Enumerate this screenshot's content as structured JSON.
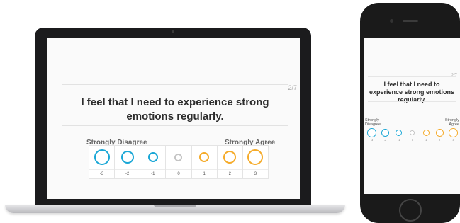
{
  "colors": {
    "blue": "#1aa7d6",
    "gray": "#c4c4c4",
    "orange": "#f5ab2a"
  },
  "laptop": {
    "progress": "2/7",
    "question": "I feel that I need to experience strong emotions regularly.",
    "label_left": "Strongly Disagree",
    "label_right": "Strongly Agree",
    "options": [
      {
        "value": "-3",
        "size": 22,
        "color": "#1aa7d6"
      },
      {
        "value": "-2",
        "size": 18,
        "color": "#1aa7d6"
      },
      {
        "value": "-1",
        "size": 14,
        "color": "#1aa7d6"
      },
      {
        "value": "0",
        "size": 11,
        "color": "#c4c4c4"
      },
      {
        "value": "1",
        "size": 14,
        "color": "#f5ab2a"
      },
      {
        "value": "2",
        "size": 18,
        "color": "#f5ab2a"
      },
      {
        "value": "3",
        "size": 22,
        "color": "#f5ab2a"
      }
    ]
  },
  "phone": {
    "progress": "2/7",
    "question": "I feel that I need to experience strong emotions regularly.",
    "label_left": "Strongly Disagree",
    "label_right": "Strongly Agree",
    "options": [
      {
        "value": "-3",
        "size": 13,
        "color": "#1aa7d6"
      },
      {
        "value": "-2",
        "size": 11,
        "color": "#1aa7d6"
      },
      {
        "value": "-1",
        "size": 9,
        "color": "#1aa7d6"
      },
      {
        "value": "0",
        "size": 7,
        "color": "#c4c4c4"
      },
      {
        "value": "1",
        "size": 9,
        "color": "#f5ab2a"
      },
      {
        "value": "2",
        "size": 11,
        "color": "#f5ab2a"
      },
      {
        "value": "3",
        "size": 13,
        "color": "#f5ab2a"
      }
    ]
  }
}
